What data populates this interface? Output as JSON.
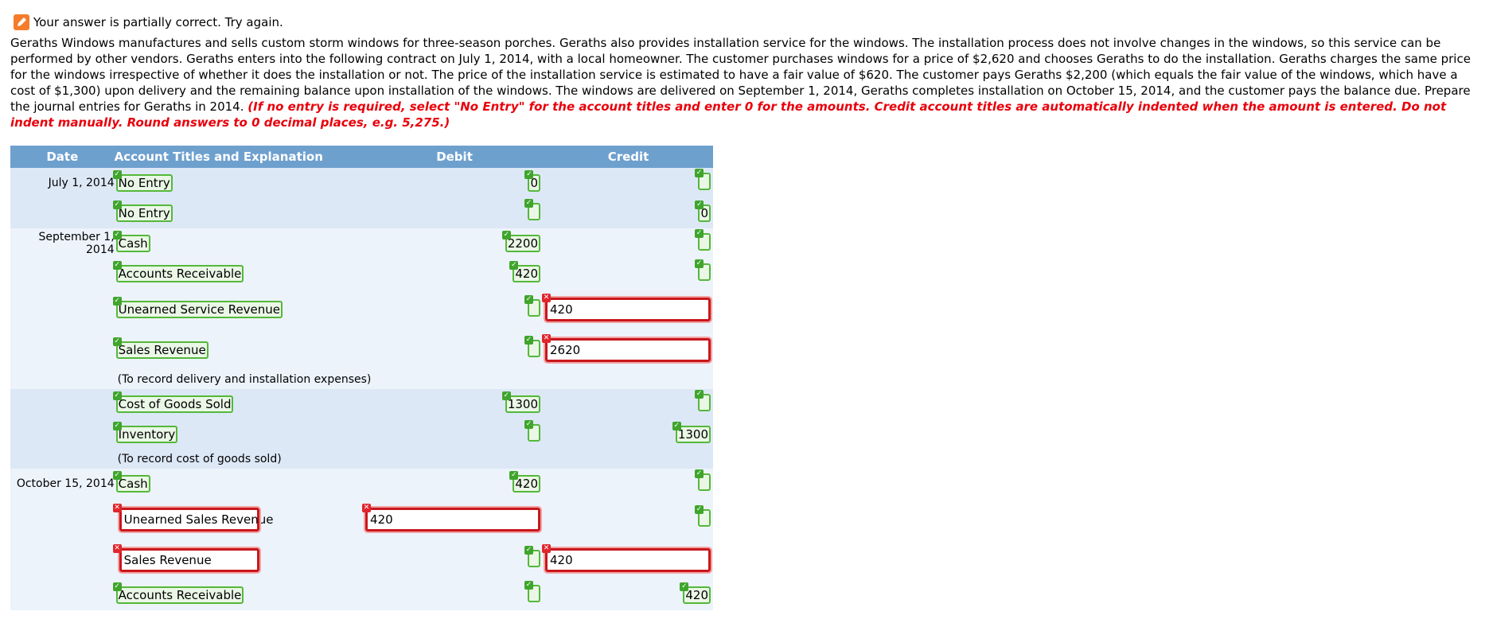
{
  "status": {
    "icon": "pencil-icon",
    "message": "Your answer is partially correct.  Try again."
  },
  "problem": {
    "text": "Geraths Windows manufactures and sells custom storm windows for three-season porches. Geraths also provides installation service for the windows. The installation process does not involve changes in the windows, so this service can be performed by other vendors. Geraths enters into the following contract on July 1, 2014, with a local homeowner. The customer purchases windows for a price of $2,620 and chooses Geraths to do the installation. Geraths charges the same price for the windows irrespective of whether it does the installation or not. The price of the installation service is estimated to have a fair value of $620. The customer pays Geraths $2,200 (which equals the fair value of the windows, which have a cost of $1,300) upon delivery and the remaining balance upon installation of the windows. The windows are delivered on September 1, 2014, Geraths completes installation on October 15, 2014, and the customer pays the balance due. Prepare the journal entries for Geraths in 2014.",
    "instructions": "(If no entry is required, select \"No Entry\" for the account titles and enter 0 for the amounts. Credit account titles are automatically indented when the amount is entered. Do not indent manually. Round answers to 0 decimal places, e.g. 5,275.)"
  },
  "table": {
    "headers": {
      "date": "Date",
      "account": "Account Titles and Explanation",
      "debit": "Debit",
      "credit": "Credit"
    },
    "rows": [
      {
        "date": "July 1, 2014",
        "account": "No Entry",
        "account_status": "correct",
        "debit": "0",
        "debit_status": "correct",
        "credit": "",
        "credit_status": "correct"
      },
      {
        "date": "",
        "account": "No Entry",
        "account_status": "correct",
        "debit": "",
        "debit_status": "correct",
        "credit": "0",
        "credit_status": "correct"
      },
      {
        "date": "September 1, 2014",
        "account": "Cash",
        "account_status": "correct",
        "debit": "2200",
        "debit_status": "correct",
        "credit": "",
        "credit_status": "correct"
      },
      {
        "date": "",
        "account": "Accounts Receivable",
        "account_status": "correct",
        "debit": "420",
        "debit_status": "correct",
        "credit": "",
        "credit_status": "correct"
      },
      {
        "date": "",
        "account": "Unearned Service Revenue",
        "account_status": "correct",
        "debit": "",
        "debit_status": "correct",
        "credit": "420",
        "credit_status": "incorrect"
      },
      {
        "date": "",
        "account": "Sales Revenue",
        "account_status": "correct",
        "debit": "",
        "debit_status": "correct",
        "credit": "2620",
        "credit_status": "incorrect"
      },
      {
        "note": "(To record delivery and installation expenses)"
      },
      {
        "date": "",
        "account": "Cost of Goods Sold",
        "account_status": "correct",
        "debit": "1300",
        "debit_status": "correct",
        "credit": "",
        "credit_status": "correct"
      },
      {
        "date": "",
        "account": "Inventory",
        "account_status": "correct",
        "debit": "",
        "debit_status": "correct",
        "credit": "1300",
        "credit_status": "correct"
      },
      {
        "note": "(To record cost of goods sold)"
      },
      {
        "date": "October 15, 2014",
        "account": "Cash",
        "account_status": "correct",
        "debit": "420",
        "debit_status": "correct",
        "credit": "",
        "credit_status": "correct"
      },
      {
        "date": "",
        "account": "Unearned Sales Revenue",
        "account_status": "incorrect",
        "debit": "420",
        "debit_status": "incorrect",
        "credit": "",
        "credit_status": "correct"
      },
      {
        "date": "",
        "account": "Sales Revenue",
        "account_status": "incorrect",
        "debit": "",
        "debit_status": "correct",
        "credit": "420",
        "credit_status": "incorrect"
      },
      {
        "date": "",
        "account": "Accounts Receivable",
        "account_status": "correct",
        "debit": "",
        "debit_status": "correct",
        "credit": "420",
        "credit_status": "correct"
      }
    ]
  },
  "colors": {
    "header_bg": "#6ea0ce",
    "band_a": "#dde8f6",
    "band_b": "#edf3fb",
    "correct": "#54b83a",
    "incorrect": "#c8171d",
    "instructions": "#e8000b",
    "status_icon": "#f57c2b"
  }
}
